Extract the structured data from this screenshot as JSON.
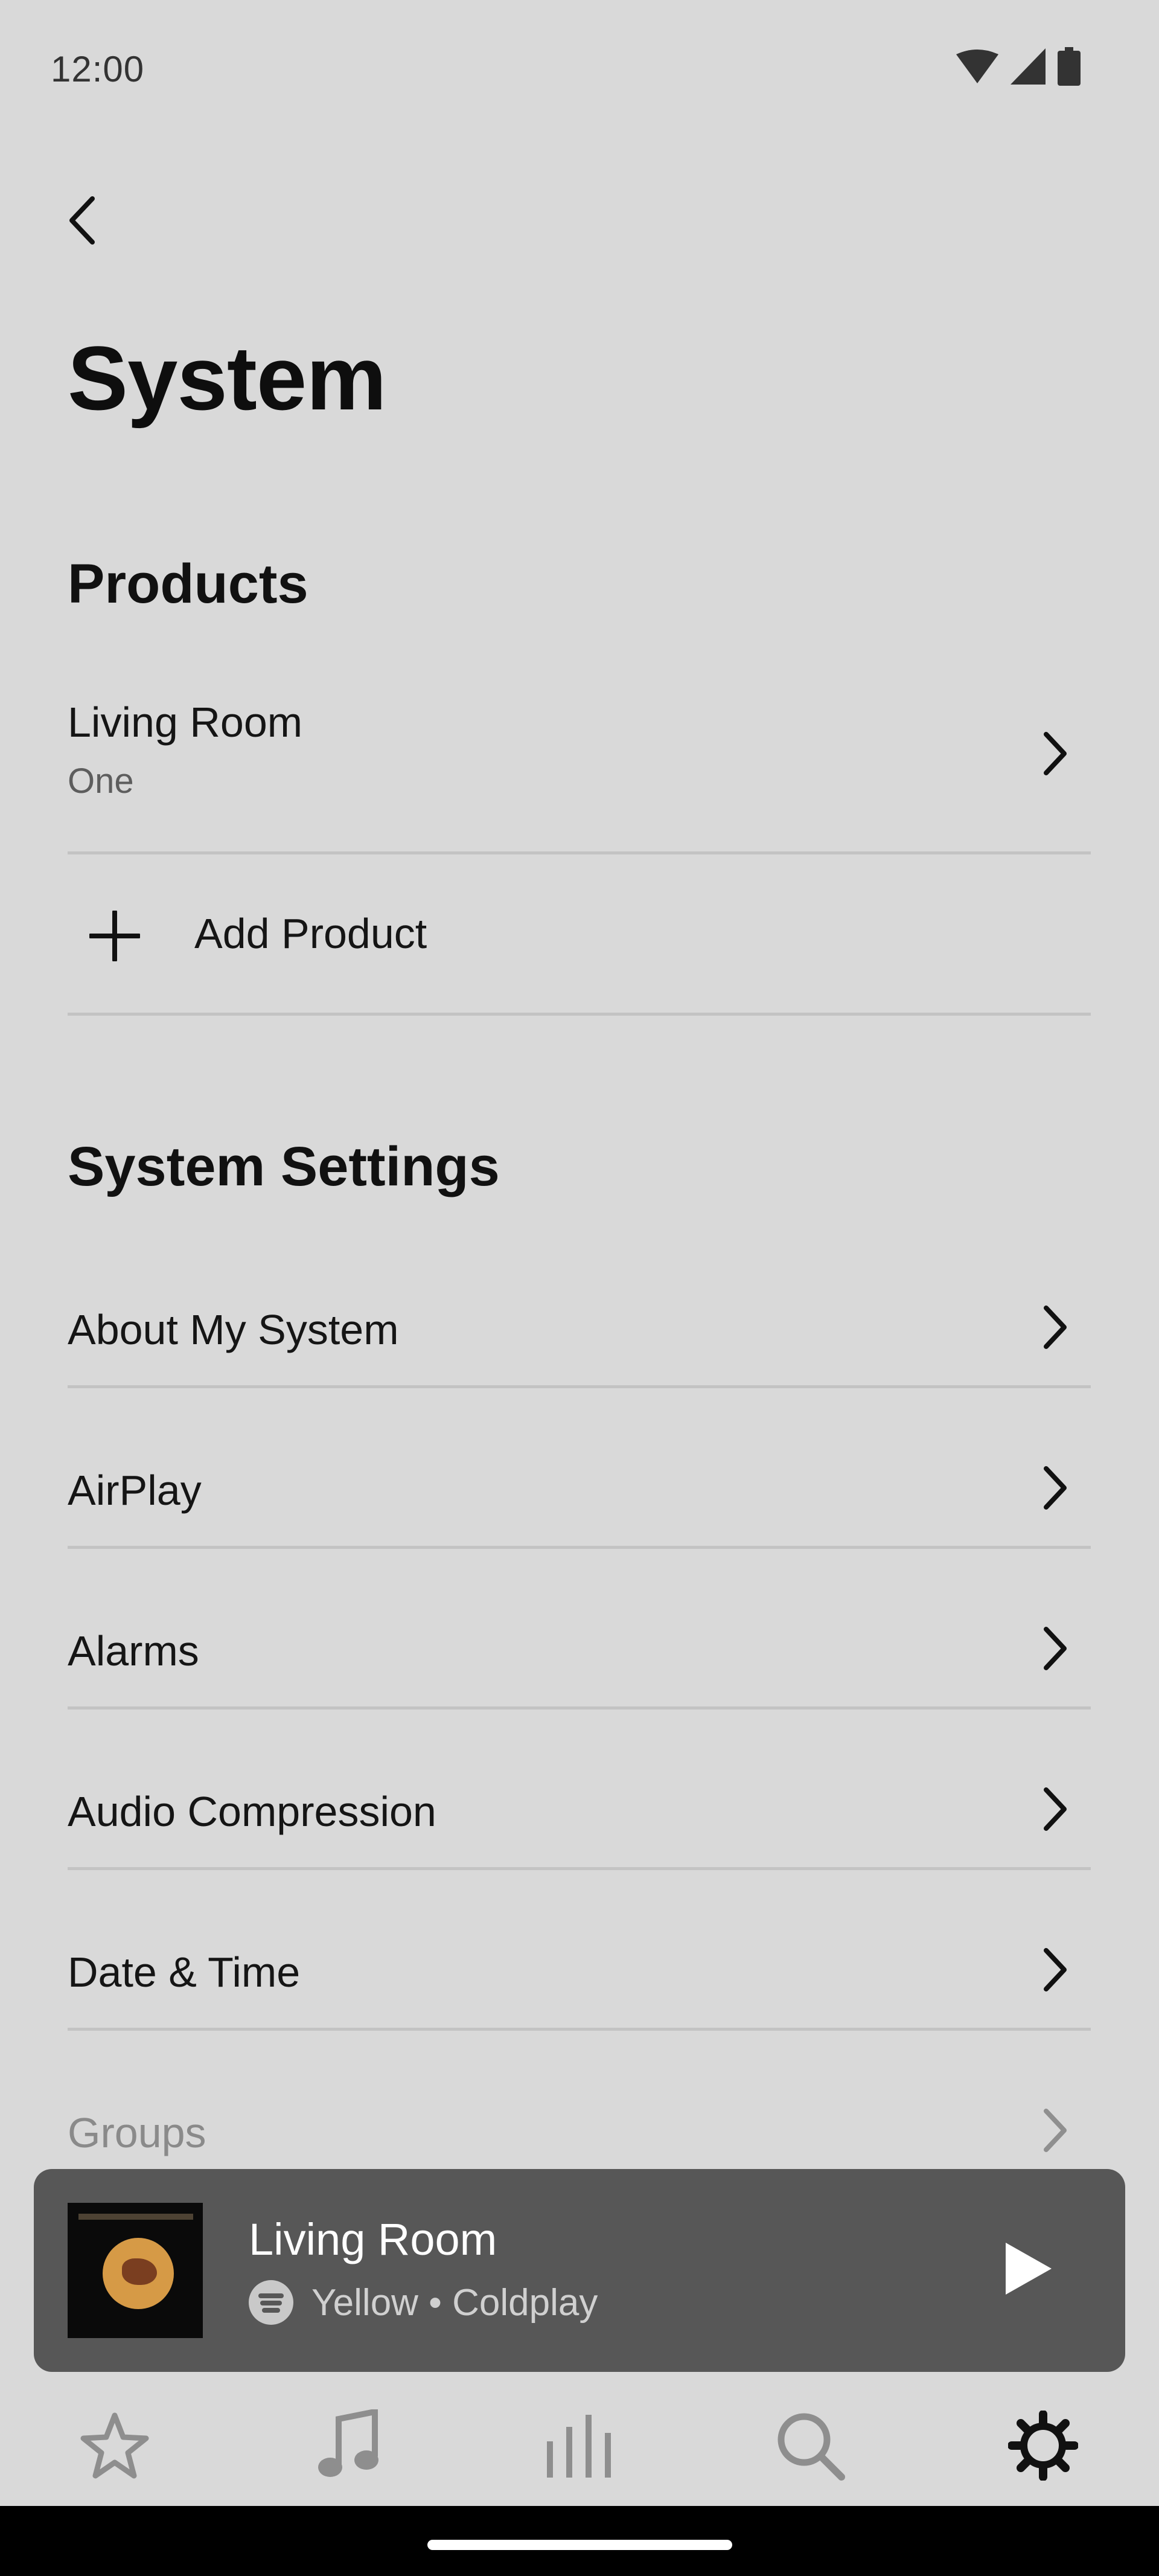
{
  "status_bar": {
    "time": "12:00"
  },
  "header": {
    "title": "System"
  },
  "products": {
    "heading": "Products",
    "items": [
      {
        "name": "Living Room",
        "model": "One"
      }
    ],
    "add_label": "Add Product"
  },
  "system_settings": {
    "heading": "System Settings",
    "items": [
      {
        "label": "About My System"
      },
      {
        "label": "AirPlay"
      },
      {
        "label": "Alarms"
      },
      {
        "label": "Audio Compression"
      },
      {
        "label": "Date & Time"
      },
      {
        "label": "Groups"
      }
    ]
  },
  "now_playing": {
    "room": "Living Room",
    "track": "Yellow • Coldplay",
    "service_icon": "spotify-icon"
  },
  "tab_bar": {
    "items": [
      {
        "icon": "star-icon",
        "active": false
      },
      {
        "icon": "music-note-icon",
        "active": false
      },
      {
        "icon": "rooms-bars-icon",
        "active": false
      },
      {
        "icon": "search-icon",
        "active": false
      },
      {
        "icon": "gear-icon",
        "active": true
      }
    ]
  },
  "colors": {
    "background": "#d9d9d9",
    "now_playing_bg": "#575757",
    "divider": "#c3c3c3",
    "inactive_tab": "#8e8e8e",
    "active_tab": "#111111"
  }
}
